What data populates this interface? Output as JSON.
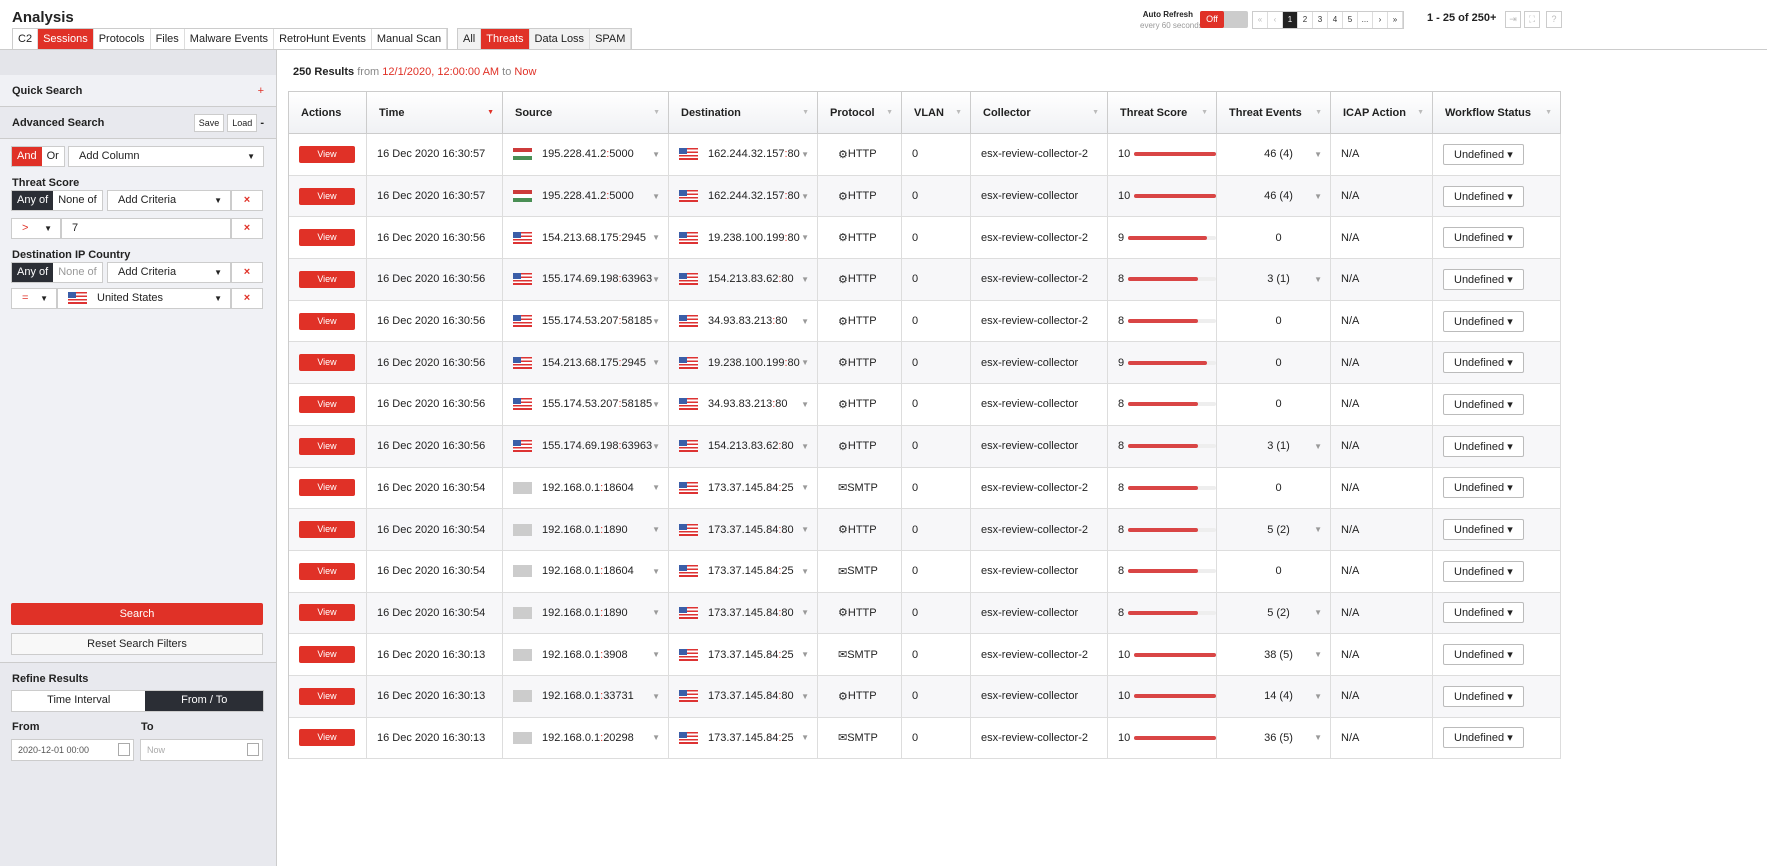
{
  "header": {
    "title": "Analysis",
    "tabs": [
      {
        "label": "C2"
      },
      {
        "label": "Sessions",
        "active": true
      },
      {
        "label": "Protocols"
      },
      {
        "label": "Files"
      },
      {
        "label": "Malware Events"
      },
      {
        "label": "RetroHunt Events"
      },
      {
        "label": "Manual Scan"
      }
    ],
    "subtabs": [
      {
        "label": "All"
      },
      {
        "label": "Threats",
        "active": true
      },
      {
        "label": "Data Loss"
      },
      {
        "label": "SPAM"
      }
    ],
    "auto_refresh": {
      "label": "Auto Refresh",
      "sub": "every 60 seconds",
      "state": "Off"
    },
    "pager": {
      "pages": [
        "1",
        "2",
        "3",
        "4",
        "5",
        "..."
      ],
      "current": "1",
      "count": "1 - 25 of 250+"
    }
  },
  "sidebar": {
    "quick_search": "Quick Search",
    "plus": "+",
    "advanced_search": "Advanced Search",
    "save": "Save",
    "load": "Load",
    "minus": "-",
    "and": "And",
    "or": "Or",
    "add_column": "Add Column",
    "f1_label": "Threat Score",
    "any_of": "Any of",
    "none_of": "None of",
    "add_criteria": "Add Criteria",
    "op1": ">",
    "value1": "7",
    "f2_label": "Destination IP Country",
    "op2": "=",
    "value2": "United States",
    "remove": "×",
    "search": "Search",
    "reset": "Reset Search Filters",
    "refine": "Refine Results",
    "time_interval": "Time Interval",
    "from_to": "From / To",
    "from_label": "From",
    "to_label": "To",
    "from_value": "2020-12-01 00:00",
    "to_placeholder": "Now"
  },
  "results": {
    "count": "250 Results",
    "from_word": "from",
    "from": "12/1/2020, 12:00:00 AM",
    "to_word": "to",
    "to": "Now"
  },
  "columns": [
    "Actions",
    "Time",
    "Source",
    "Destination",
    "Protocol",
    "VLAN",
    "Collector",
    "Threat Score",
    "Threat Events",
    "ICAP Action",
    "Workflow Status"
  ],
  "rows": [
    {
      "time": "16 Dec 2020 16:30:57",
      "sf": "hu",
      "sip": "195.228.41.2",
      "sport": "5000",
      "dip": "162.244.32.157",
      "dport": "80",
      "proto": "HTTP",
      "vlan": "0",
      "coll": "esx-review-collector-2",
      "score": 10,
      "events": "46 (4)"
    },
    {
      "time": "16 Dec 2020 16:30:57",
      "sf": "hu",
      "sip": "195.228.41.2",
      "sport": "5000",
      "dip": "162.244.32.157",
      "dport": "80",
      "proto": "HTTP",
      "vlan": "0",
      "coll": "esx-review-collector",
      "score": 10,
      "events": "46 (4)"
    },
    {
      "time": "16 Dec 2020 16:30:56",
      "sf": "us",
      "sip": "154.213.68.175",
      "sport": "2945",
      "dip": "19.238.100.199",
      "dport": "80",
      "proto": "HTTP",
      "vlan": "0",
      "coll": "esx-review-collector-2",
      "score": 9,
      "events": "0"
    },
    {
      "time": "16 Dec 2020 16:30:56",
      "sf": "us",
      "sip": "155.174.69.198",
      "sport": "63963",
      "dip": "154.213.83.62",
      "dport": "80",
      "proto": "HTTP",
      "vlan": "0",
      "coll": "esx-review-collector-2",
      "score": 8,
      "events": "3 (1)"
    },
    {
      "time": "16 Dec 2020 16:30:56",
      "sf": "us",
      "sip": "155.174.53.207",
      "sport": "58185",
      "dip": "34.93.83.213",
      "dport": "80",
      "proto": "HTTP",
      "vlan": "0",
      "coll": "esx-review-collector-2",
      "score": 8,
      "events": "0"
    },
    {
      "time": "16 Dec 2020 16:30:56",
      "sf": "us",
      "sip": "154.213.68.175",
      "sport": "2945",
      "dip": "19.238.100.199",
      "dport": "80",
      "proto": "HTTP",
      "vlan": "0",
      "coll": "esx-review-collector",
      "score": 9,
      "events": "0"
    },
    {
      "time": "16 Dec 2020 16:30:56",
      "sf": "us",
      "sip": "155.174.53.207",
      "sport": "58185",
      "dip": "34.93.83.213",
      "dport": "80",
      "proto": "HTTP",
      "vlan": "0",
      "coll": "esx-review-collector",
      "score": 8,
      "events": "0"
    },
    {
      "time": "16 Dec 2020 16:30:56",
      "sf": "us",
      "sip": "155.174.69.198",
      "sport": "63963",
      "dip": "154.213.83.62",
      "dport": "80",
      "proto": "HTTP",
      "vlan": "0",
      "coll": "esx-review-collector",
      "score": 8,
      "events": "3 (1)"
    },
    {
      "time": "16 Dec 2020 16:30:54",
      "sf": "pv",
      "sip": "192.168.0.1",
      "sport": "18604",
      "dip": "173.37.145.84",
      "dport": "25",
      "proto": "SMTP",
      "vlan": "0",
      "coll": "esx-review-collector-2",
      "score": 8,
      "events": "0"
    },
    {
      "time": "16 Dec 2020 16:30:54",
      "sf": "pv",
      "sip": "192.168.0.1",
      "sport": "1890",
      "dip": "173.37.145.84",
      "dport": "80",
      "proto": "HTTP",
      "vlan": "0",
      "coll": "esx-review-collector-2",
      "score": 8,
      "events": "5 (2)"
    },
    {
      "time": "16 Dec 2020 16:30:54",
      "sf": "pv",
      "sip": "192.168.0.1",
      "sport": "18604",
      "dip": "173.37.145.84",
      "dport": "25",
      "proto": "SMTP",
      "vlan": "0",
      "coll": "esx-review-collector",
      "score": 8,
      "events": "0"
    },
    {
      "time": "16 Dec 2020 16:30:54",
      "sf": "pv",
      "sip": "192.168.0.1",
      "sport": "1890",
      "dip": "173.37.145.84",
      "dport": "80",
      "proto": "HTTP",
      "vlan": "0",
      "coll": "esx-review-collector",
      "score": 8,
      "events": "5 (2)"
    },
    {
      "time": "16 Dec 2020 16:30:13",
      "sf": "pv",
      "sip": "192.168.0.1",
      "sport": "3908",
      "dip": "173.37.145.84",
      "dport": "25",
      "proto": "SMTP",
      "vlan": "0",
      "coll": "esx-review-collector-2",
      "score": 10,
      "events": "38 (5)"
    },
    {
      "time": "16 Dec 2020 16:30:13",
      "sf": "pv",
      "sip": "192.168.0.1",
      "sport": "33731",
      "dip": "173.37.145.84",
      "dport": "80",
      "proto": "HTTP",
      "vlan": "0",
      "coll": "esx-review-collector",
      "score": 10,
      "events": "14 (4)"
    },
    {
      "time": "16 Dec 2020 16:30:13",
      "sf": "pv",
      "sip": "192.168.0.1",
      "sport": "20298",
      "dip": "173.37.145.84",
      "dport": "25",
      "proto": "SMTP",
      "vlan": "0",
      "coll": "esx-review-collector-2",
      "score": 10,
      "events": "36 (5)"
    }
  ],
  "row_labels": {
    "view": "View",
    "icap": "N/A",
    "workflow": "Undefined"
  }
}
